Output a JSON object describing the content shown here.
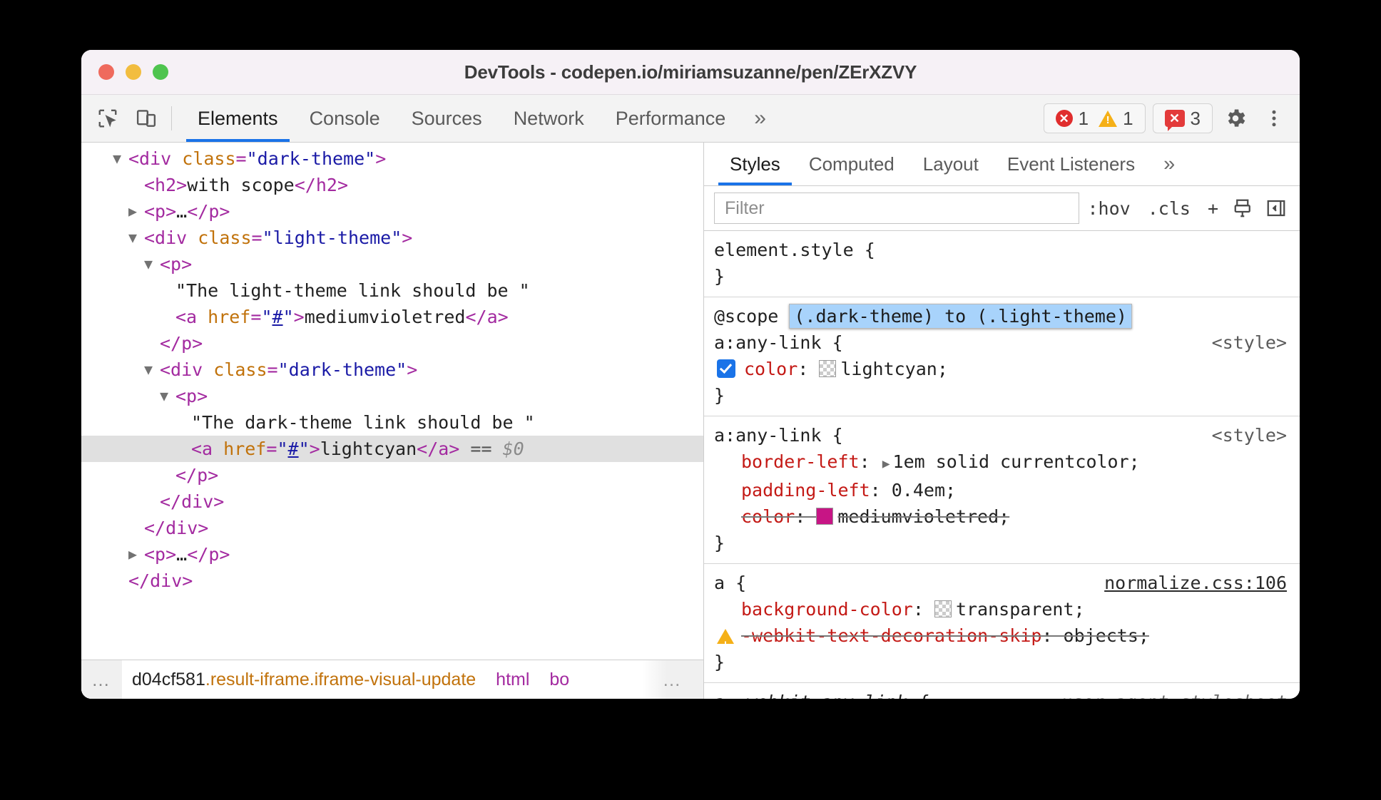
{
  "window": {
    "title": "DevTools - codepen.io/miriamsuzanne/pen/ZErXZVY"
  },
  "toolbar": {
    "inspect_icon": "inspect-element-icon",
    "device_icon": "device-toolbar-icon",
    "tabs": [
      {
        "label": "Elements",
        "active": true
      },
      {
        "label": "Console",
        "active": false
      },
      {
        "label": "Sources",
        "active": false
      },
      {
        "label": "Network",
        "active": false
      },
      {
        "label": "Performance",
        "active": false
      }
    ],
    "more_label": "»",
    "badges": {
      "errors": "1",
      "warnings": "1",
      "issues": "3"
    },
    "settings_label": "⚙",
    "kebab_label": "⋮"
  },
  "dom_tree": {
    "rows": [
      {
        "indent": 1,
        "twisty": "open",
        "parts": [
          {
            "t": "tag",
            "s": "<div "
          },
          {
            "t": "attr",
            "s": "class"
          },
          {
            "t": "tag",
            "s": "="
          },
          {
            "t": "val",
            "s": "\"dark-theme\""
          },
          {
            "t": "tag",
            "s": ">"
          }
        ]
      },
      {
        "indent": 2,
        "twisty": "none",
        "parts": [
          {
            "t": "tag",
            "s": "<h2>"
          },
          {
            "t": "txt",
            "s": "with scope"
          },
          {
            "t": "tag",
            "s": "</h2>"
          }
        ]
      },
      {
        "indent": 2,
        "twisty": "closed",
        "parts": [
          {
            "t": "tag",
            "s": "<p>"
          },
          {
            "t": "txt",
            "s": "…"
          },
          {
            "t": "tag",
            "s": "</p>"
          }
        ]
      },
      {
        "indent": 2,
        "twisty": "open",
        "parts": [
          {
            "t": "tag",
            "s": "<div "
          },
          {
            "t": "attr",
            "s": "class"
          },
          {
            "t": "tag",
            "s": "="
          },
          {
            "t": "val",
            "s": "\"light-theme\""
          },
          {
            "t": "tag",
            "s": ">"
          }
        ]
      },
      {
        "indent": 3,
        "twisty": "open",
        "parts": [
          {
            "t": "tag",
            "s": "<p>"
          }
        ]
      },
      {
        "indent": 4,
        "twisty": "none",
        "parts": [
          {
            "t": "txt",
            "s": "\"The light-theme link should be \""
          }
        ]
      },
      {
        "indent": 4,
        "twisty": "none",
        "parts": [
          {
            "t": "tag",
            "s": "<a "
          },
          {
            "t": "attr",
            "s": "href"
          },
          {
            "t": "tag",
            "s": "="
          },
          {
            "t": "val",
            "s": "\""
          },
          {
            "t": "hashlink",
            "s": "#"
          },
          {
            "t": "val",
            "s": "\""
          },
          {
            "t": "tag",
            "s": ">"
          },
          {
            "t": "txt",
            "s": "mediumvioletred"
          },
          {
            "t": "tag",
            "s": "</a>"
          }
        ]
      },
      {
        "indent": 3,
        "twisty": "none",
        "parts": [
          {
            "t": "tag",
            "s": "</p>"
          }
        ]
      },
      {
        "indent": 3,
        "twisty": "open",
        "parts": [
          {
            "t": "tag",
            "s": "<div "
          },
          {
            "t": "attr",
            "s": "class"
          },
          {
            "t": "tag",
            "s": "="
          },
          {
            "t": "val",
            "s": "\"dark-theme\""
          },
          {
            "t": "tag",
            "s": ">"
          }
        ]
      },
      {
        "indent": 4,
        "twisty": "open",
        "parts": [
          {
            "t": "tag",
            "s": "<p>"
          }
        ]
      },
      {
        "indent": 5,
        "twisty": "none",
        "parts": [
          {
            "t": "txt",
            "s": "\"The dark-theme link should be \""
          }
        ]
      },
      {
        "indent": 5,
        "twisty": "none",
        "selected": true,
        "parts": [
          {
            "t": "tag",
            "s": "<a "
          },
          {
            "t": "attr",
            "s": "href"
          },
          {
            "t": "tag",
            "s": "="
          },
          {
            "t": "val",
            "s": "\""
          },
          {
            "t": "hashlink",
            "s": "#"
          },
          {
            "t": "val",
            "s": "\""
          },
          {
            "t": "tag",
            "s": ">"
          },
          {
            "t": "txt",
            "s": "lightcyan"
          },
          {
            "t": "tag",
            "s": "</a>"
          },
          {
            "t": "eq",
            "s": " == "
          },
          {
            "t": "dollar",
            "s": "$0"
          }
        ]
      },
      {
        "indent": 4,
        "twisty": "none",
        "parts": [
          {
            "t": "tag",
            "s": "</p>"
          }
        ]
      },
      {
        "indent": 3,
        "twisty": "none",
        "parts": [
          {
            "t": "tag",
            "s": "</div>"
          }
        ]
      },
      {
        "indent": 2,
        "twisty": "none",
        "parts": [
          {
            "t": "tag",
            "s": "</div>"
          }
        ]
      },
      {
        "indent": 2,
        "twisty": "closed",
        "parts": [
          {
            "t": "tag",
            "s": "<p>"
          },
          {
            "t": "txt",
            "s": "…"
          },
          {
            "t": "tag",
            "s": "</p>"
          }
        ]
      },
      {
        "indent": 1,
        "twisty": "none",
        "parts": [
          {
            "t": "tag",
            "s": "</div>"
          }
        ]
      }
    ]
  },
  "breadcrumb": {
    "leading_ellipsis": "…",
    "items": [
      {
        "tag": "d04cf581",
        "cls": ".result-iframe.iframe-visual-update"
      },
      {
        "tag": "html",
        "cls": ""
      },
      {
        "tag": "bo",
        "cls": ""
      }
    ],
    "trailing_ellipsis": "…"
  },
  "styles_pane": {
    "tabs": [
      {
        "label": "Styles",
        "active": true
      },
      {
        "label": "Computed",
        "active": false
      },
      {
        "label": "Layout",
        "active": false
      },
      {
        "label": "Event Listeners",
        "active": false
      }
    ],
    "more_label": "»",
    "filter": {
      "placeholder": "Filter",
      "value": ""
    },
    "hov_label": ":hov",
    "cls_label": ".cls",
    "new_rule_label": "+",
    "print_icon": "print-media-icon",
    "sidebar_toggle_icon": "toggle-sidebar-icon",
    "rules": [
      {
        "selector": "element.style {",
        "origin": "",
        "declarations": [],
        "closing": "}"
      },
      {
        "scope": {
          "keyword": "@scope",
          "prelude": "(.dark-theme) to (.light-theme)"
        },
        "selector": "a:any-link {",
        "origin": "<style>",
        "declarations": [
          {
            "checkbox": true,
            "name": "color",
            "value": "lightcyan",
            "swatch": "#e0ffff",
            "swatch_checker": true,
            "struck": false
          }
        ],
        "closing": "}"
      },
      {
        "selector": "a:any-link {",
        "origin": "<style>",
        "declarations": [
          {
            "name": "border-left",
            "value": "1em solid currentcolor",
            "expandable": true,
            "struck": false
          },
          {
            "name": "padding-left",
            "value": "0.4em",
            "struck": false
          },
          {
            "name": "color",
            "value": "mediumvioletred",
            "swatch": "#c71585",
            "struck": true
          }
        ],
        "closing": "}"
      },
      {
        "selector": "a {",
        "origin": "normalize.css:106",
        "origin_link": true,
        "declarations": [
          {
            "name": "background-color",
            "value": "transparent",
            "swatch_checker": true,
            "struck": false
          },
          {
            "warning": true,
            "name": "-webkit-text-decoration-skip",
            "value": "objects",
            "struck": true
          }
        ],
        "closing": "}"
      },
      {
        "selector": "a:-webkit-any-link {",
        "origin": "user agent stylesheet",
        "origin_ua": true,
        "selector_italic": true,
        "declarations": [],
        "closing": ""
      }
    ]
  }
}
